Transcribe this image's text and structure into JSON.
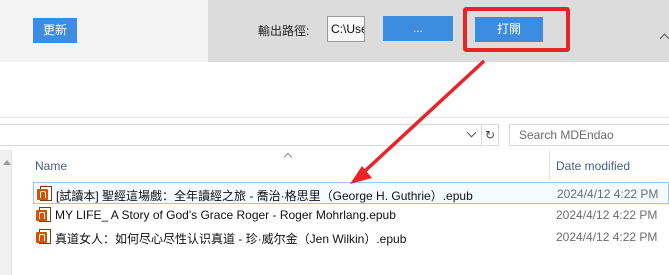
{
  "toolbar": {
    "update_label": "更新",
    "output_path_label": "輸出路徑:",
    "output_path_value": "C:\\Use",
    "browse_label": "...",
    "open_label": "打開"
  },
  "explorer": {
    "search_placeholder": "Search MDEndao",
    "refresh_icon": "refresh-icon",
    "columns": {
      "name": "Name",
      "date_modified": "Date modified"
    },
    "files": [
      {
        "name": "[試讀本] 聖經這場戲：全年讀經之旅 - 喬治·格思里（George H. Guthrie）.epub",
        "date": "2024/4/12 4:22 PM"
      },
      {
        "name": "MY LIFE_ A Story of God's Grace Roger - Roger Mohrlang.epub",
        "date": "2024/4/12 4:22 PM"
      },
      {
        "name": "真道女人：如何尽心尽性认识真道 - 珍·威尔金（Jen Wilkin）.epub",
        "date": "2024/4/12 4:22 PM"
      }
    ]
  },
  "colors": {
    "button_blue": "#3c8ce0",
    "highlight_red": "#e8232a",
    "header_text": "#4c607a",
    "selection_border": "#99c9ef"
  }
}
